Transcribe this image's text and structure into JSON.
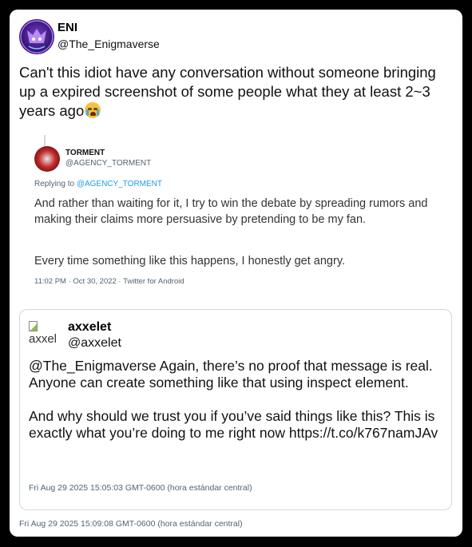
{
  "tweet": {
    "name": "ENI",
    "handle": "@The_Enigmaverse",
    "text": "Can't this idiot have any conversation without someone bringing up a expired screenshot of some people what they at least 2~3 years ago",
    "emoji_icon": "loudly-crying-face",
    "timestamp": "Fri Aug 29 2025 15:09:08 GMT-0600 (hora estándar central)"
  },
  "screenshot": {
    "name": "TORMENT",
    "handle": "@AGENCY_TORMENT",
    "replying_prefix": "Replying to ",
    "replying_handle": "@AGENCY_TORMENT",
    "paragraph1": "And rather than waiting for it, I try to win the debate by spreading rumors and making their claims more persuasive by pretending to be my fan.",
    "paragraph2": "Every time something like this happens, I honestly get angry.",
    "meta": "11:02 PM · Oct 30, 2022 · Twitter for Android"
  },
  "quote": {
    "avatar_alt": "axxel",
    "name": "axxelet",
    "handle": "@axxelet",
    "line1": "@The_Enigmaverse Again, there’s no proof that message is real. Anyone can create something like that using inspect element.",
    "line2": "And why should we trust you if you’ve said things like this? This is exactly what you’re doing to me right now https://t.co/k767namJAv",
    "timestamp": "Fri Aug 29 2025 15:05:03 GMT-0600 (hora estándar central)"
  }
}
